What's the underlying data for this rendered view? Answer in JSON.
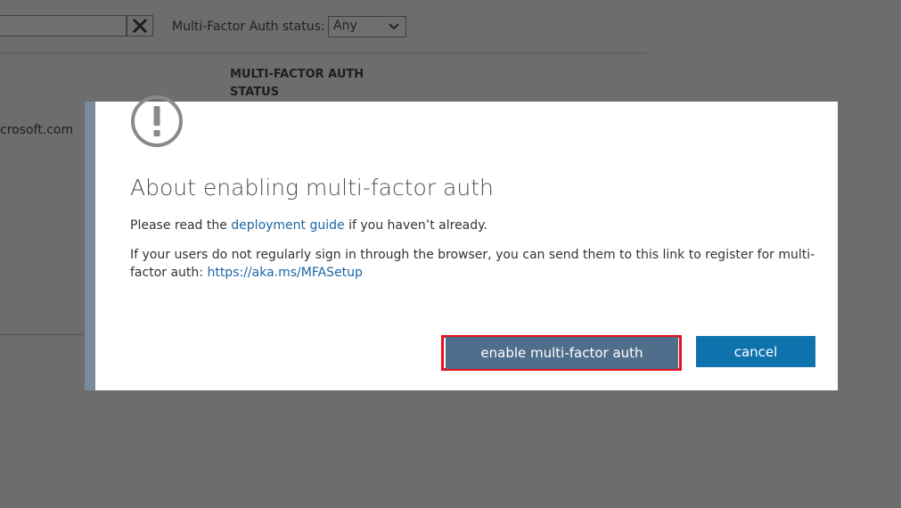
{
  "background": {
    "search_value": "",
    "clear_icon": "close-icon",
    "status_label": "Multi-Factor Auth status:",
    "status_select_value": "Any",
    "column_header_line1": "MULTI-FACTOR AUTH",
    "column_header_line2": "STATUS",
    "row_email_fragment": "crosoft.com"
  },
  "dialog": {
    "icon": "exclamation-circle-icon",
    "title": "About enabling multi-factor auth",
    "para1_prefix": "Please read the ",
    "para1_link": "deployment guide",
    "para1_suffix": " if you haven’t already.",
    "para2_text": "If your users do not regularly sign in through the browser, you can send them to this link to register for multi-factor auth: ",
    "para2_link": "https://aka.ms/MFASetup",
    "enable_button": "enable multi-factor auth",
    "cancel_button": "cancel",
    "colors": {
      "enable_button_bg": "#4f6e8b",
      "cancel_button_bg": "#0e72ac",
      "highlight_border": "#e8101e",
      "link": "#1a66a6"
    }
  }
}
